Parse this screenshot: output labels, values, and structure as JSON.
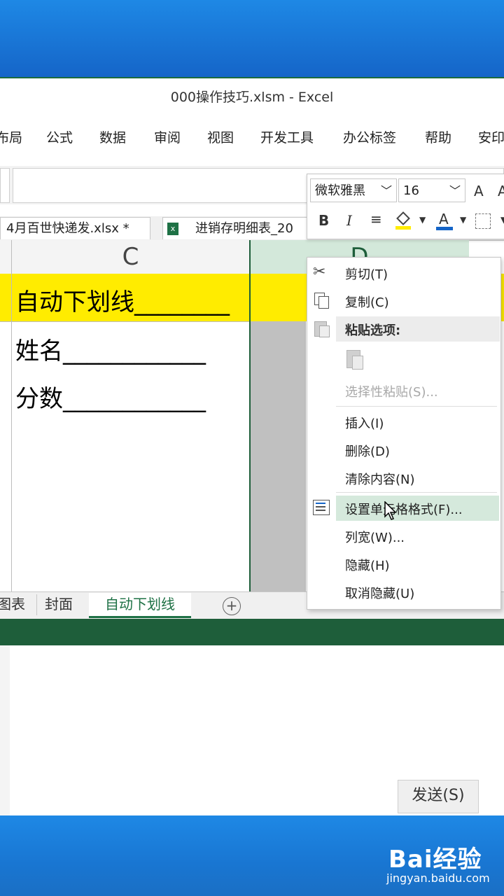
{
  "window": {
    "title": "000操作技巧.xlsm  -  Excel"
  },
  "ribbon_tabs": [
    "布局",
    "公式",
    "数据",
    "审阅",
    "视图",
    "开发工具",
    "办公标签",
    "帮助",
    "安印"
  ],
  "file_tabs": [
    {
      "label": "4月百世快递发.xlsx *"
    },
    {
      "label": "进销存明细表_20"
    }
  ],
  "columns": {
    "c": "C",
    "d": "D"
  },
  "cells": {
    "header": "自动下划线________",
    "name": "姓名____________",
    "score": "分数____________"
  },
  "sheet_tabs": [
    "图表",
    "封面",
    "自动下划线"
  ],
  "active_sheet": "自动下划线",
  "mini_toolbar": {
    "font_name": "微软雅黑",
    "font_size": "16",
    "grow_font": "A",
    "bold": "B",
    "italic": "I",
    "font_color_glyph": "A",
    "accent_color": "#1565c8",
    "highlight_color": "#ffec00"
  },
  "context_menu": {
    "cut": "剪切(T)",
    "copy": "复制(C)",
    "paste_options": "粘贴选项:",
    "paste_special": "选择性粘贴(S)...",
    "insert": "插入(I)",
    "delete": "删除(D)",
    "clear": "清除内容(N)",
    "format_cells": "设置单元格格式(F)...",
    "column_width": "列宽(W)...",
    "hide": "隐藏(H)",
    "unhide": "取消隐藏(U)"
  },
  "send_button": "发送(S)",
  "watermark": {
    "brand": "Bai经验",
    "url": "jingyan.baidu.com"
  },
  "colors": {
    "excel_green": "#1e5e3a",
    "menu_hover": "#d5e9dc"
  }
}
